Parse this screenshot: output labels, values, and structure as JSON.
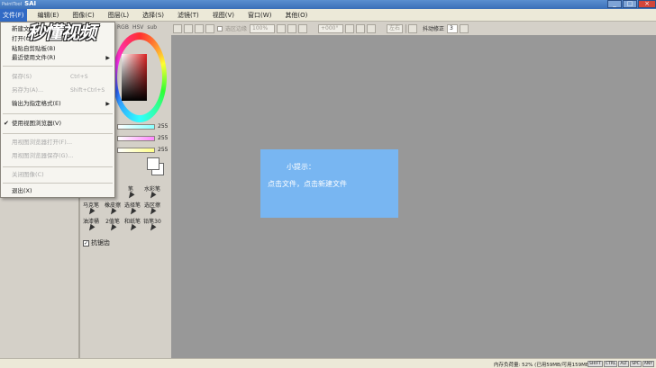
{
  "app": {
    "logo_small": "PaintTool",
    "logo_big": "SAI",
    "window_buttons": [
      "_",
      "□",
      "×"
    ]
  },
  "menubar": [
    {
      "label": "文件(F)",
      "active": true
    },
    {
      "label": "编辑(E)"
    },
    {
      "label": "图像(C)"
    },
    {
      "label": "图层(L)"
    },
    {
      "label": "选择(S)"
    },
    {
      "label": "滤镜(T)"
    },
    {
      "label": "视图(V)"
    },
    {
      "label": "窗口(W)"
    },
    {
      "label": "其他(O)"
    }
  ],
  "toolbar": {
    "antialias_label": "选区边缘",
    "zoom": "100%",
    "angle": "+000°",
    "flip": "左右",
    "stabilizer_label": "抖动修正",
    "stabilizer_value": "3"
  },
  "file_menu": {
    "items": [
      {
        "label": "新建文件(N)...",
        "shortcut": "Ctrl+N"
      },
      {
        "label": "打开(O)...",
        "shortcut": "Ctrl+O"
      },
      {
        "label": "粘贴自剪贴板(B)"
      },
      {
        "label": "最近使用文件(R)",
        "submenu": true
      },
      {
        "label": "保存(S)",
        "shortcut": "Ctrl+S",
        "disabled": true
      },
      {
        "label": "另存为(A)...",
        "shortcut": "Shift+Ctrl+S",
        "disabled": true
      },
      {
        "label": "输出为指定格式(E)",
        "submenu": true
      },
      {
        "label": "使用视图浏览器(V)",
        "checked": true
      },
      {
        "label": "用视图浏览器打开(F)...",
        "disabled": true
      },
      {
        "label": "用视图浏览器保存(G)...",
        "disabled": true
      },
      {
        "label": "关闭图像(C)",
        "disabled": true
      },
      {
        "label": "退出(X)"
      }
    ]
  },
  "watermark": "秒懂视频",
  "color_panel": {
    "strip_labels": [
      "RGB",
      "HSV",
      "sub"
    ],
    "slider_values": [
      "255",
      "255",
      "255"
    ]
  },
  "tools": [
    {
      "label": "笔"
    },
    {
      "label": "水彩笔"
    },
    {
      "label": "马克笔"
    },
    {
      "label": "橡皮擦"
    },
    {
      "label": "选择笔"
    },
    {
      "label": "选区擦"
    },
    {
      "label": "油漆桶"
    },
    {
      "label": "2值笔"
    },
    {
      "label": "和纸笔"
    },
    {
      "label": "铅笔30"
    }
  ],
  "antialias": {
    "label": "抗锯齿",
    "checked": true
  },
  "tip": {
    "title": "小提示：",
    "text": "点击文件，点击新建文件"
  },
  "statusbar": {
    "memory": "内存负荷量: 52% (已用59MB/可用159MB)",
    "keys": [
      "SHIFT",
      "CTRL",
      "ALT",
      "SPC",
      "ANY"
    ]
  },
  "colors": {
    "menu_highlight": "#316ac5",
    "canvas_bg": "#989898",
    "tip_bg": "#78b6f2"
  }
}
